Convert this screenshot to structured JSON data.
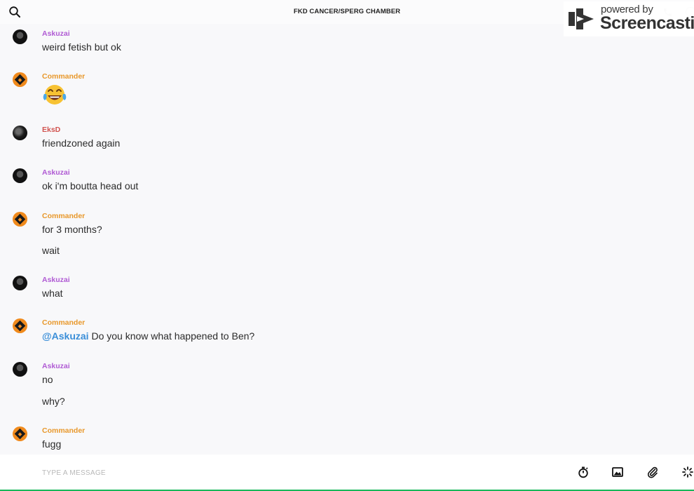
{
  "header": {
    "title": "FKD CANCER/SPERG CHAMBER"
  },
  "watermark": {
    "powered": "powered by",
    "brand": "Screencastify"
  },
  "messages": [
    {
      "author": "Askuzai",
      "lines": [
        "weird fetish but ok"
      ]
    },
    {
      "author": "Commander",
      "emoji": "face-with-tears-of-joy"
    },
    {
      "author": "EksD",
      "lines": [
        "friendzoned again"
      ]
    },
    {
      "author": "Askuzai",
      "lines": [
        "ok i'm boutta head out"
      ]
    },
    {
      "author": "Commander",
      "lines": [
        "for 3 months?",
        "wait"
      ]
    },
    {
      "author": "Askuzai",
      "lines": [
        "what"
      ]
    },
    {
      "author": "Commander",
      "mention": "@Askuzai",
      "lines": [
        "Do you know what happened to Ben?"
      ]
    },
    {
      "author": "Askuzai",
      "lines": [
        "no",
        "why?"
      ]
    },
    {
      "author": "Commander",
      "lines": [
        "fugg"
      ]
    }
  ],
  "composer": {
    "placeholder": "TYPE A MESSAGE",
    "value": ""
  },
  "icons": {
    "search": "search-icon",
    "timer": "timer-icon",
    "image": "image-icon",
    "attach": "paperclip-icon",
    "spinner": "spinner-icon"
  },
  "colors": {
    "askuzai": "#b05bd4",
    "commander": "#e8982b",
    "eksd": "#d1534f",
    "mention": "#3a8ed8",
    "accent_bar": "#17b85a"
  }
}
